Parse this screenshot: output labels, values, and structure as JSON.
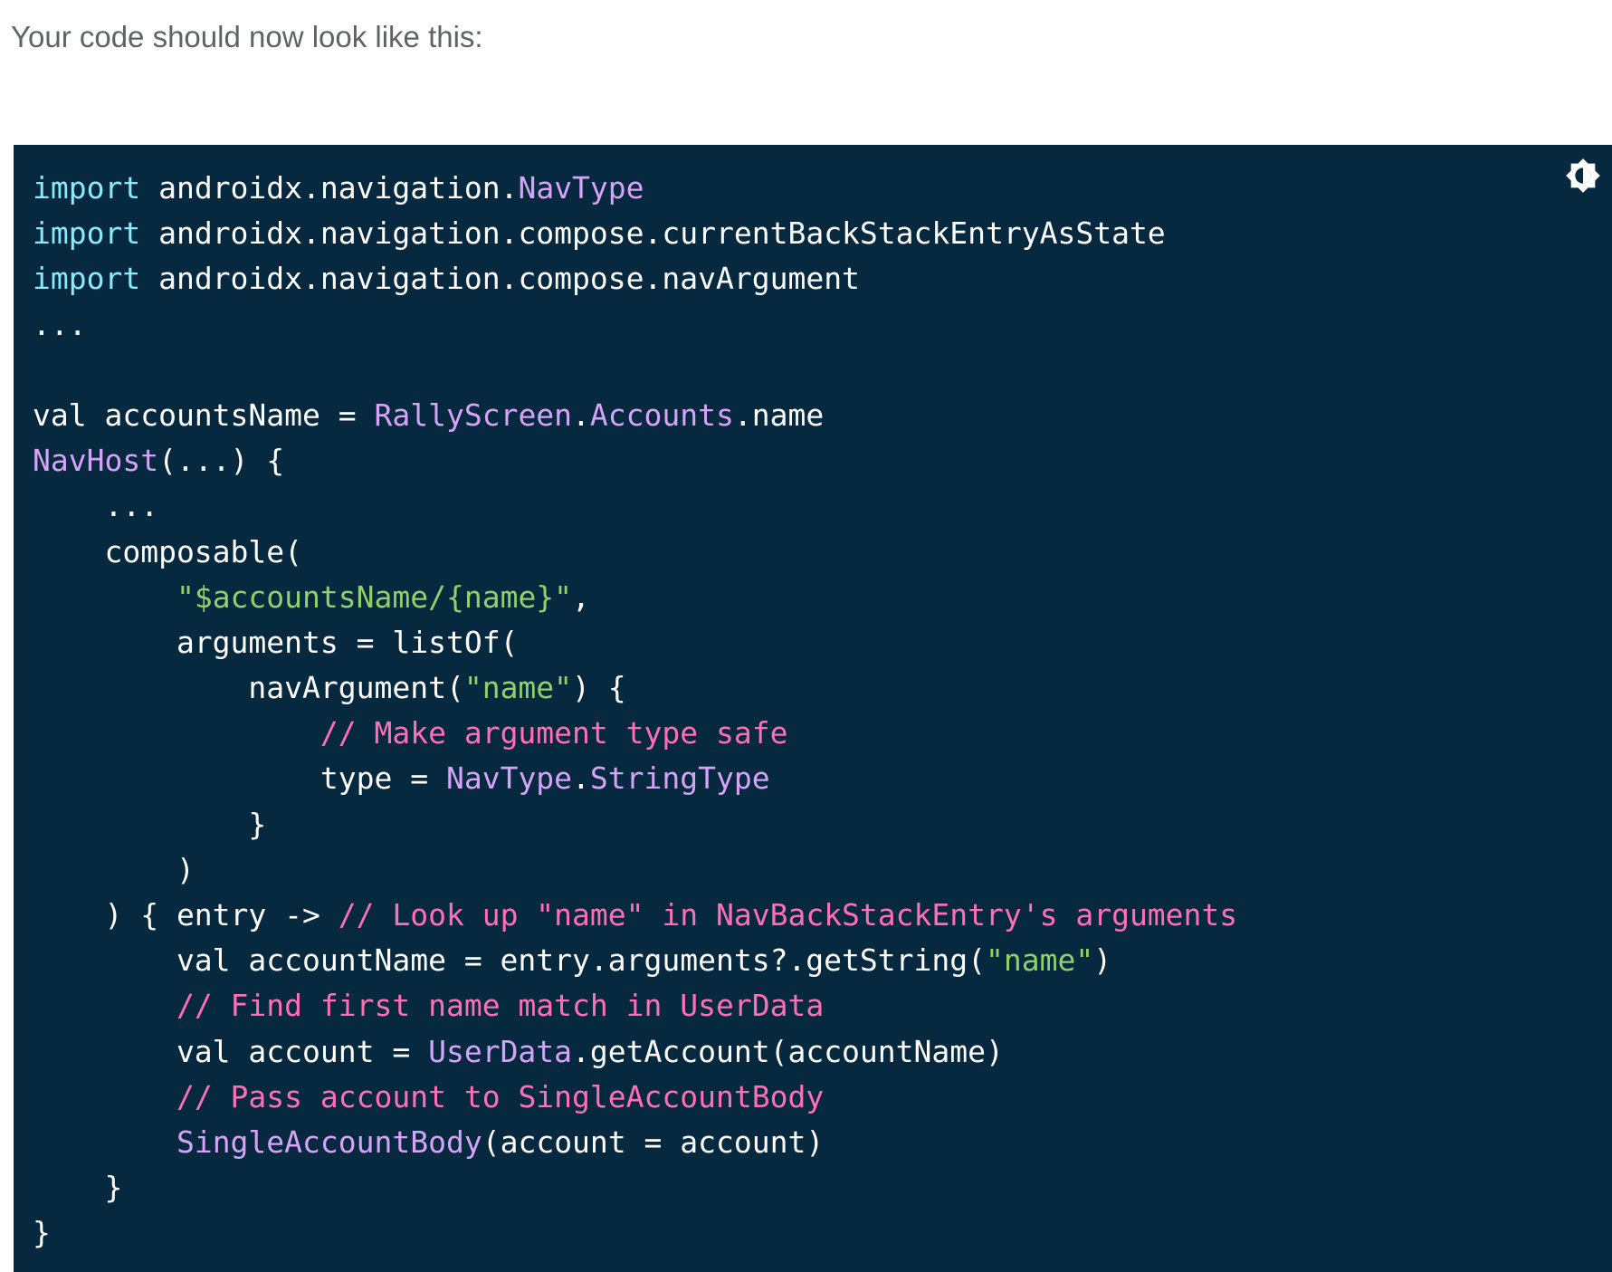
{
  "intro": {
    "text": "Your code should now look like this:"
  },
  "code_block": {
    "language": "kotlin",
    "theme_toggle_icon": "brightness-icon",
    "colors": {
      "background": "#07293f",
      "keyword": "#8be9fd",
      "type": "#d6a4f7",
      "string": "#8fd16a",
      "comment": "#ff6fb5",
      "text": "#ffffff"
    },
    "lines": [
      [
        {
          "t": "kw",
          "v": "import"
        },
        {
          "t": "txt",
          "v": " androidx.navigation."
        },
        {
          "t": "type",
          "v": "NavType"
        }
      ],
      [
        {
          "t": "kw",
          "v": "import"
        },
        {
          "t": "txt",
          "v": " androidx.navigation.compose.currentBackStackEntryAsState"
        }
      ],
      [
        {
          "t": "kw",
          "v": "import"
        },
        {
          "t": "txt",
          "v": " androidx.navigation.compose.navArgument"
        }
      ],
      [
        {
          "t": "txt",
          "v": "..."
        }
      ],
      [],
      [
        {
          "t": "txt",
          "v": "val accountsName = "
        },
        {
          "t": "type",
          "v": "RallyScreen"
        },
        {
          "t": "txt",
          "v": "."
        },
        {
          "t": "type",
          "v": "Accounts"
        },
        {
          "t": "txt",
          "v": ".name"
        }
      ],
      [
        {
          "t": "type",
          "v": "NavHost"
        },
        {
          "t": "txt",
          "v": "(...) {"
        }
      ],
      [
        {
          "t": "txt",
          "v": "    ..."
        }
      ],
      [
        {
          "t": "txt",
          "v": "    composable("
        }
      ],
      [
        {
          "t": "txt",
          "v": "        "
        },
        {
          "t": "str",
          "v": "\"$accountsName/{name}\""
        },
        {
          "t": "txt",
          "v": ","
        }
      ],
      [
        {
          "t": "txt",
          "v": "        arguments = listOf("
        }
      ],
      [
        {
          "t": "txt",
          "v": "            navArgument("
        },
        {
          "t": "str",
          "v": "\"name\""
        },
        {
          "t": "txt",
          "v": ") {"
        }
      ],
      [
        {
          "t": "txt",
          "v": "                "
        },
        {
          "t": "com",
          "v": "// Make argument type safe"
        }
      ],
      [
        {
          "t": "txt",
          "v": "                type = "
        },
        {
          "t": "type",
          "v": "NavType"
        },
        {
          "t": "txt",
          "v": "."
        },
        {
          "t": "type",
          "v": "StringType"
        }
      ],
      [
        {
          "t": "txt",
          "v": "            }"
        }
      ],
      [
        {
          "t": "txt",
          "v": "        )"
        }
      ],
      [
        {
          "t": "txt",
          "v": "    ) { entry -> "
        },
        {
          "t": "com",
          "v": "// Look up \"name\" in NavBackStackEntry's arguments"
        }
      ],
      [
        {
          "t": "txt",
          "v": "        val accountName = entry.arguments?.getString("
        },
        {
          "t": "str",
          "v": "\"name\""
        },
        {
          "t": "txt",
          "v": ")"
        }
      ],
      [
        {
          "t": "txt",
          "v": "        "
        },
        {
          "t": "com",
          "v": "// Find first name match in UserData"
        }
      ],
      [
        {
          "t": "txt",
          "v": "        val account = "
        },
        {
          "t": "type",
          "v": "UserData"
        },
        {
          "t": "txt",
          "v": ".getAccount(accountName)"
        }
      ],
      [
        {
          "t": "txt",
          "v": "        "
        },
        {
          "t": "com",
          "v": "// Pass account to SingleAccountBody"
        }
      ],
      [
        {
          "t": "txt",
          "v": "        "
        },
        {
          "t": "type",
          "v": "SingleAccountBody"
        },
        {
          "t": "txt",
          "v": "(account = account)"
        }
      ],
      [
        {
          "t": "txt",
          "v": "    }"
        }
      ],
      [
        {
          "t": "txt",
          "v": "}"
        }
      ]
    ]
  }
}
